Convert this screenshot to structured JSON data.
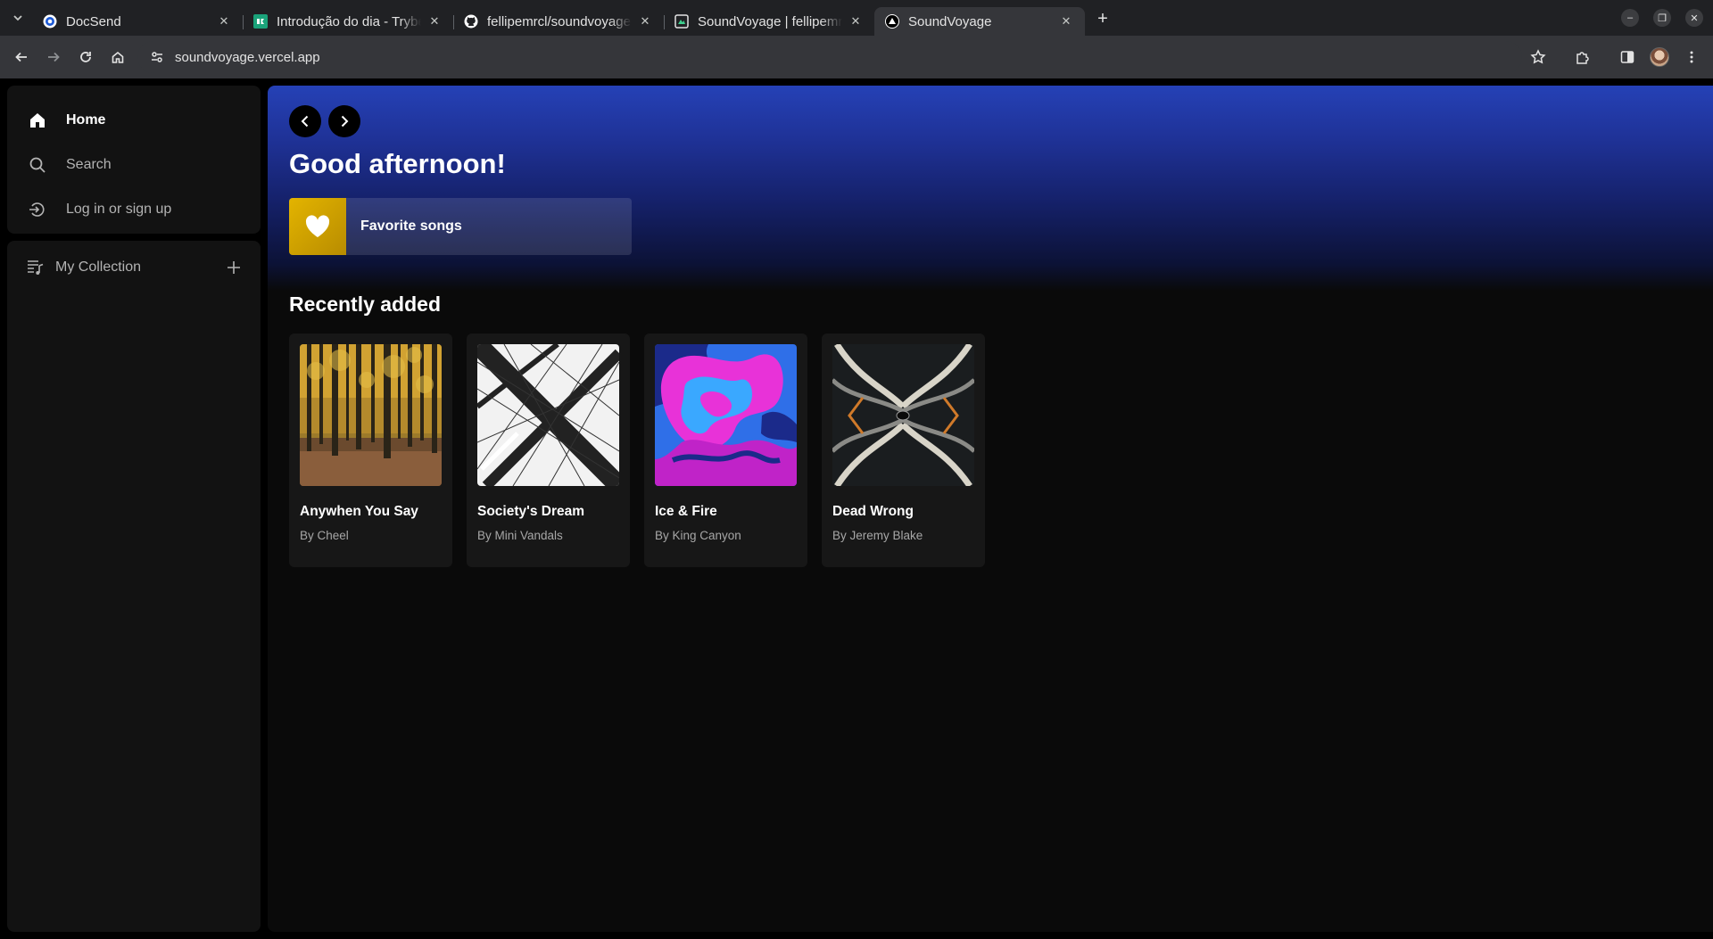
{
  "browser": {
    "tabs": [
      {
        "title": "DocSend",
        "icon": "docsend-icon",
        "active": false
      },
      {
        "title": "Introdução do dia - Trybe",
        "icon": "trybe-icon",
        "active": false
      },
      {
        "title": "fellipemrcl/soundvoyage",
        "icon": "github-icon",
        "active": false
      },
      {
        "title": "SoundVoyage | fellipemrcl",
        "icon": "vercel-project-icon",
        "active": false
      },
      {
        "title": "SoundVoyage",
        "icon": "vercel-icon",
        "active": true
      }
    ],
    "url": "soundvoyage.vercel.app"
  },
  "sidebar": {
    "nav": [
      {
        "label": "Home",
        "icon": "home-icon"
      },
      {
        "label": "Search",
        "icon": "search-icon"
      },
      {
        "label": "Log in or sign up",
        "icon": "login-icon"
      }
    ],
    "collection_label": "My Collection"
  },
  "main": {
    "greeting": "Good afternoon!",
    "favorites_label": "Favorite songs",
    "section_title": "Recently added",
    "albums": [
      {
        "title": "Anywhen You Say",
        "artist": "By Cheel"
      },
      {
        "title": "Society's Dream",
        "artist": "By Mini Vandals"
      },
      {
        "title": "Ice & Fire",
        "artist": "By King Canyon"
      },
      {
        "title": "Dead Wrong",
        "artist": "By Jeremy Blake"
      }
    ]
  },
  "colors": {
    "header_gradient_top": "#2541b6",
    "favorites_accent": "#e3b400",
    "background": "#0a0a0a"
  }
}
